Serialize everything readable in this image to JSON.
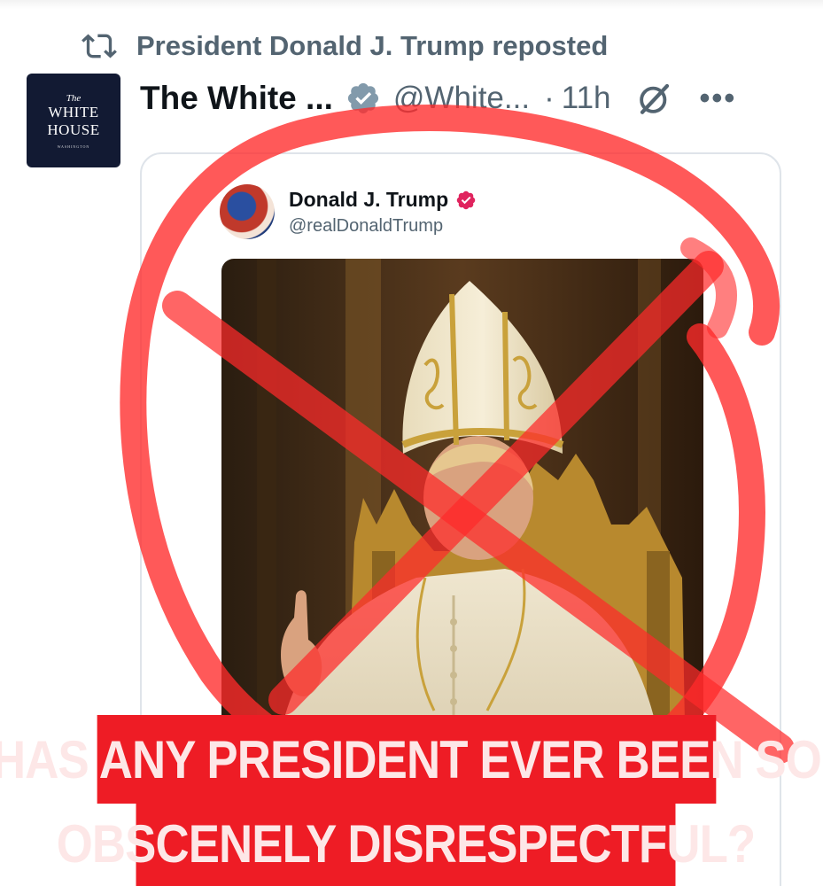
{
  "repost": {
    "icon": "repost-icon",
    "text": "President Donald J. Trump reposted"
  },
  "post": {
    "avatar": {
      "line1": "The",
      "line2": "WHITE",
      "line3": "HOUSE",
      "line4": "WASHINGTON"
    },
    "display_name": "The White ...",
    "verified_badge": "gray-verified-icon",
    "handle": "@White...",
    "separator": "·",
    "timestamp": "11h",
    "grok_icon": "grok-icon",
    "more_icon": "more-icon",
    "more_glyph": "•••"
  },
  "quoted_post": {
    "name": "Donald J. Trump",
    "verified_badge": "verified-icon",
    "handle": "@realDonaldTrump",
    "image": "pope-figure-image"
  },
  "overlay": {
    "line1": "HAS ANY PRESIDENT EVER BEEN SO",
    "line2": "OBSCENELY DISRESPECTFUL?",
    "banner_color": "#ee1c25",
    "scribble_color": "#ff2a2a"
  }
}
